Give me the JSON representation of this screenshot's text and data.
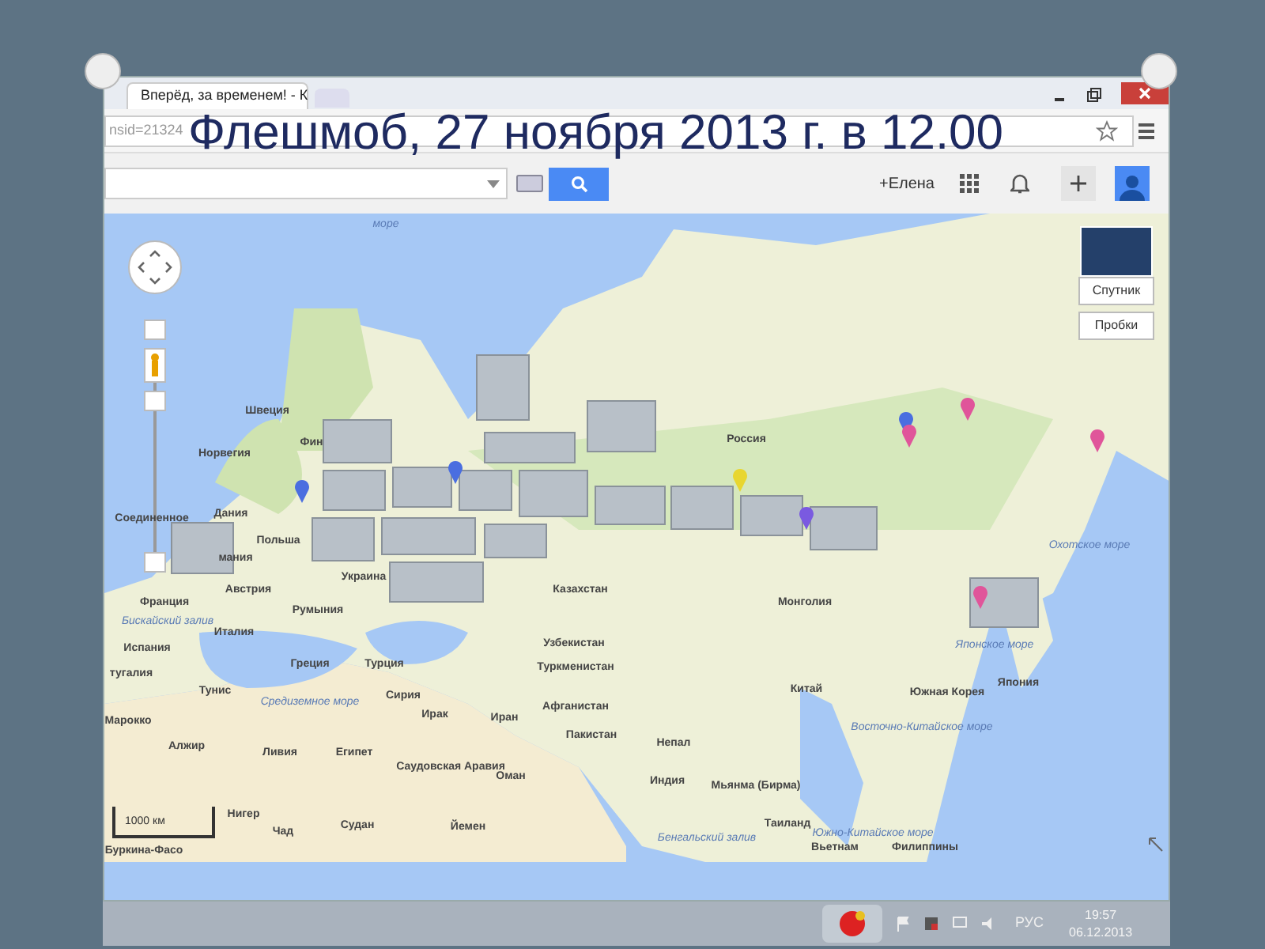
{
  "slide_title": "Флешмоб, 27 ноября 2013 г. в 12.00",
  "browser": {
    "tab_title": "Вперёд, за временем! - К",
    "address": "nsid=21324"
  },
  "toolbar": {
    "account": "+Елена"
  },
  "map": {
    "labels": [
      {
        "text": "море",
        "kind": "sea"
      },
      {
        "text": "Швеция",
        "kind": "country"
      },
      {
        "text": "Норвегия",
        "kind": "country"
      },
      {
        "text": "Фин",
        "kind": "country"
      },
      {
        "text": "Россия",
        "kind": "country"
      },
      {
        "text": "Соединенное",
        "kind": "country"
      },
      {
        "text": "Дания",
        "kind": "country"
      },
      {
        "text": "Польша",
        "kind": "country"
      },
      {
        "text": "мания",
        "kind": "country"
      },
      {
        "text": "Украина",
        "kind": "country"
      },
      {
        "text": "Австрия",
        "kind": "country"
      },
      {
        "text": "Франция",
        "kind": "country"
      },
      {
        "text": "Бискайский залив",
        "kind": "sea"
      },
      {
        "text": "Румыния",
        "kind": "country"
      },
      {
        "text": "Италия",
        "kind": "country"
      },
      {
        "text": "Испания",
        "kind": "country"
      },
      {
        "text": "тугалия",
        "kind": "country"
      },
      {
        "text": "Греция",
        "kind": "country"
      },
      {
        "text": "Турция",
        "kind": "country"
      },
      {
        "text": "Казахстан",
        "kind": "country"
      },
      {
        "text": "Узбекистан",
        "kind": "country"
      },
      {
        "text": "Туркменистан",
        "kind": "country"
      },
      {
        "text": "Сирия",
        "kind": "country"
      },
      {
        "text": "Ирак",
        "kind": "country"
      },
      {
        "text": "Иран",
        "kind": "country"
      },
      {
        "text": "Афганистан",
        "kind": "country"
      },
      {
        "text": "Пакистан",
        "kind": "country"
      },
      {
        "text": "Средиземное море",
        "kind": "sea"
      },
      {
        "text": "Тунис",
        "kind": "country"
      },
      {
        "text": "Марокко",
        "kind": "country"
      },
      {
        "text": "Алжир",
        "kind": "country"
      },
      {
        "text": "Ливия",
        "kind": "country"
      },
      {
        "text": "Египет",
        "kind": "country"
      },
      {
        "text": "Саудовская Аравия",
        "kind": "country"
      },
      {
        "text": "Оман",
        "kind": "country"
      },
      {
        "text": "Судан",
        "kind": "country"
      },
      {
        "text": "Йемен",
        "kind": "country"
      },
      {
        "text": "Чад",
        "kind": "country"
      },
      {
        "text": "Нигер",
        "kind": "country"
      },
      {
        "text": "Буркина-Фасо",
        "kind": "country"
      },
      {
        "text": "Монголия",
        "kind": "country"
      },
      {
        "text": "Китай",
        "kind": "country"
      },
      {
        "text": "Непал",
        "kind": "country"
      },
      {
        "text": "Индия",
        "kind": "country"
      },
      {
        "text": "Мьянма (Бирма)",
        "kind": "country"
      },
      {
        "text": "Таиланд",
        "kind": "country"
      },
      {
        "text": "Вьетнам",
        "kind": "country"
      },
      {
        "text": "Филиппины",
        "kind": "country"
      },
      {
        "text": "Бенгальский залив",
        "kind": "sea"
      },
      {
        "text": "Южно-Китайское море",
        "kind": "sea"
      },
      {
        "text": "Южная Корея",
        "kind": "country"
      },
      {
        "text": "Восточно-Китайское море",
        "kind": "sea"
      },
      {
        "text": "Япония",
        "kind": "country"
      },
      {
        "text": "Японское море",
        "kind": "sea"
      },
      {
        "text": "Охотское море",
        "kind": "sea"
      }
    ],
    "markers": [
      {
        "color": "#4a6ee0"
      },
      {
        "color": "#4a6ee0"
      },
      {
        "color": "#4a6ee0"
      },
      {
        "color": "#e0559a"
      },
      {
        "color": "#e0559a"
      },
      {
        "color": "#e0559a"
      },
      {
        "color": "#e8d630"
      },
      {
        "color": "#7a5ae0"
      },
      {
        "color": "#e0559a"
      }
    ],
    "scale": "1000 км",
    "layers": [
      {
        "label": "Спутник"
      },
      {
        "label": "Пробки"
      }
    ]
  },
  "taskbar": {
    "language": "РУС",
    "time": "19:57",
    "date": "06.12.2013"
  }
}
